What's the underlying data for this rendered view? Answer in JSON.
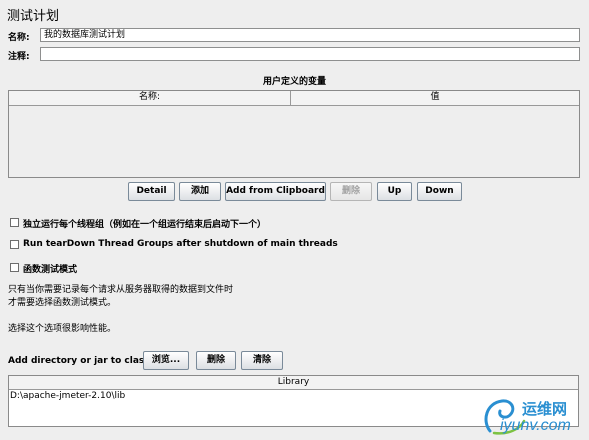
{
  "panel": {
    "title": "测试计划"
  },
  "fields": {
    "name_label": "名称:",
    "name_value": "我的数据库测试计划",
    "comment_label": "注释:",
    "comment_value": ""
  },
  "variables": {
    "section_title": "用户定义的变量",
    "columns": [
      "名称:",
      "值"
    ]
  },
  "var_buttons": {
    "detail": "Detail",
    "add": "添加",
    "add_clipboard": "Add from Clipboard",
    "delete": "删除",
    "up": "Up",
    "down": "Down"
  },
  "options": {
    "independent": {
      "label": "独立运行每个线程组（例如在一个组运行结束后启动下一个）",
      "checked": false
    },
    "teardown": {
      "label": "Run tearDown Thread Groups after shutdown of main threads",
      "checked": false
    },
    "functional": {
      "label": "函数测试模式",
      "checked": false
    }
  },
  "notes": {
    "line1": "只有当你需要记录每个请求从服务器取得的数据到文件时",
    "line2": "才需要选择函数测试模式。",
    "line3": "选择这个选项很影响性能。"
  },
  "classpath": {
    "label": "Add directory or jar to classpath",
    "browse": "浏览...",
    "delete": "删除",
    "clear": "清除",
    "column": "Library",
    "rows": [
      "D:\\apache-jmeter-2.10\\lib"
    ]
  },
  "watermark": {
    "text_cn": "运维网",
    "text_en": "iyunv.com",
    "color": "#2a8fd1"
  }
}
